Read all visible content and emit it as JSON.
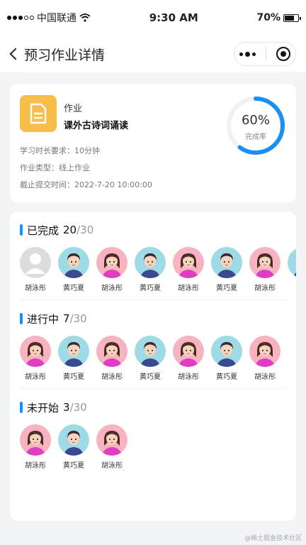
{
  "status_bar": {
    "carrier": "中国联通",
    "time": "9:30 AM",
    "battery": "70%",
    "battery_level": 0.7
  },
  "navbar": {
    "title": "预习作业详情"
  },
  "assignment": {
    "label": "作业",
    "name": "课外古诗词诵读",
    "duration": "学习时长要求：10分钟",
    "type": "作业类型：线上作业",
    "deadline": "截止提交时间：2022-7-20 10:00:00",
    "percent_text": "60%",
    "percent_label": "完成率",
    "percent_value": 0.6
  },
  "sections": [
    {
      "title": "已完成",
      "count": "20",
      "total": "/30",
      "people": [
        {
          "name": "胡泳彤",
          "avatar": "empty"
        },
        {
          "name": "黄巧夏",
          "avatar": "boy"
        },
        {
          "name": "胡泳彤",
          "avatar": "girl"
        },
        {
          "name": "黄巧夏",
          "avatar": "boy"
        },
        {
          "name": "胡泳彤",
          "avatar": "girl"
        },
        {
          "name": "黄巧夏",
          "avatar": "boy"
        },
        {
          "name": "胡泳彤",
          "avatar": "girl"
        },
        {
          "name": "黄",
          "avatar": "boy"
        }
      ]
    },
    {
      "title": "进行中",
      "count": "7",
      "total": "/30",
      "people": [
        {
          "name": "胡泳彤",
          "avatar": "girl"
        },
        {
          "name": "黄巧夏",
          "avatar": "boy"
        },
        {
          "name": "胡泳彤",
          "avatar": "girl"
        },
        {
          "name": "黄巧夏",
          "avatar": "boy"
        },
        {
          "name": "胡泳彤",
          "avatar": "girl"
        },
        {
          "name": "黄巧夏",
          "avatar": "boy"
        },
        {
          "name": "胡泳彤",
          "avatar": "girl"
        }
      ]
    },
    {
      "title": "未开始",
      "count": "3",
      "total": "/30",
      "people": [
        {
          "name": "胡泳彤",
          "avatar": "girl"
        },
        {
          "name": "黄巧夏",
          "avatar": "boy"
        },
        {
          "name": "胡泳彤",
          "avatar": "girl"
        }
      ]
    }
  ],
  "watermark": "@稀土掘金技术社区",
  "colors": {
    "accent": "#1a8ff5",
    "doc_icon_bg": "#f7be4a",
    "girl_bg": "#f7b4c0",
    "boy_bg": "#9fdbe6"
  },
  "icons": {
    "back": "chevron-left-icon",
    "more": "more-dots-icon",
    "close": "target-circle-icon",
    "document": "document-icon",
    "wifi": "wifi-icon",
    "battery": "battery-icon"
  }
}
